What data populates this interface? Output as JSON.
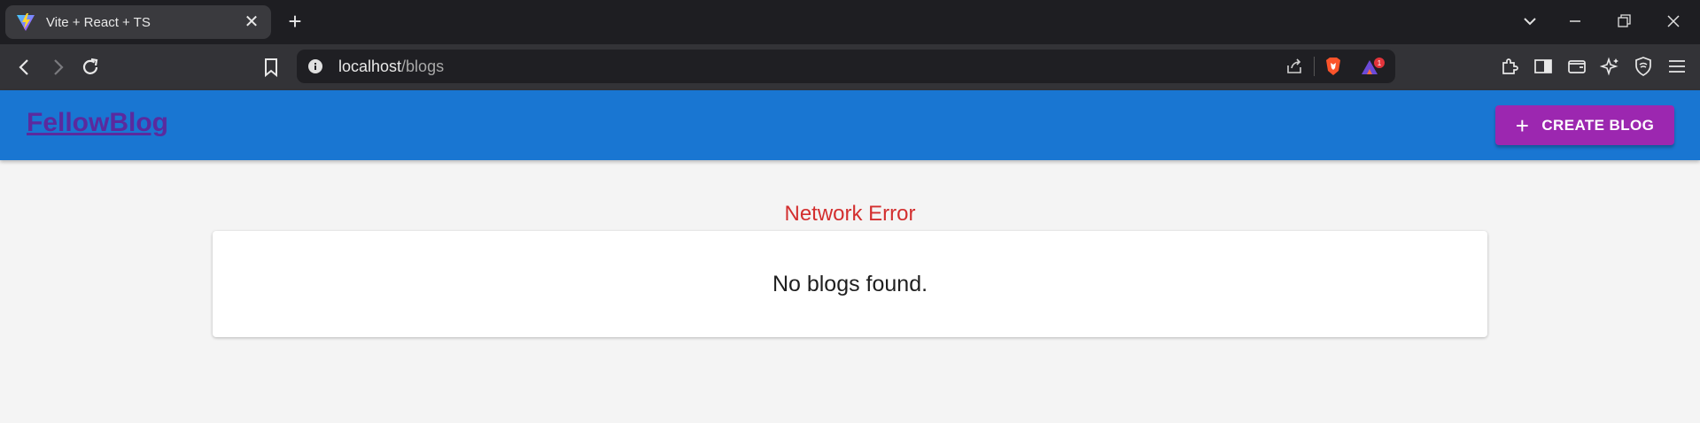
{
  "browser": {
    "tab_title": "Vite + React + TS",
    "url_host": "localhost",
    "url_path": "/blogs",
    "notification_badge": "1"
  },
  "header": {
    "brand": "FellowBlog",
    "create_button": "CREATE BLOG"
  },
  "main": {
    "error_text": "Network Error",
    "empty_message": "No blogs found."
  },
  "colors": {
    "appbar": "#1976d2",
    "create_button": "#9c27b0",
    "error": "#d32f2f"
  }
}
